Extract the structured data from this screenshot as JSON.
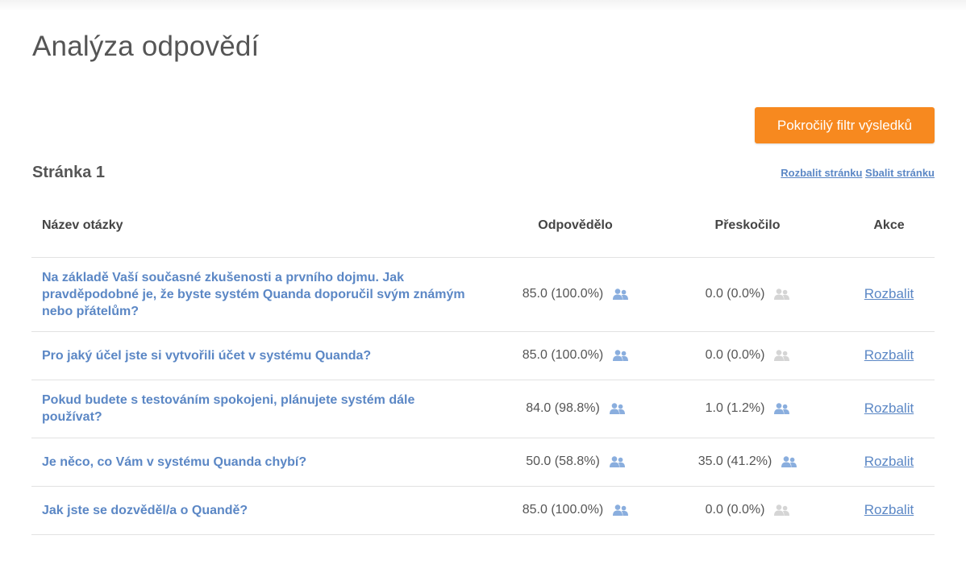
{
  "header": {
    "title": "Analýza odpovědí",
    "filter_button_label": "Pokročilý filtr výsledků"
  },
  "page_section": {
    "heading": "Stránka 1",
    "expand_page_label": "Rozbalit stránku",
    "collapse_page_label": "Sbalit stránku"
  },
  "table": {
    "columns": {
      "question": "Název otázky",
      "answered": "Odpovědělo",
      "skipped": "Přeskočilo",
      "action": "Akce"
    },
    "rows": [
      {
        "question": "Na základě Vaší současné zkušenosti a prvního dojmu. Jak pravděpodobné je, že byste systém Quanda doporučil svým známým nebo přátelům?",
        "answered": "85.0 (100.0%)",
        "skipped": "0.0 (0.0%)",
        "action": "Rozbalit",
        "answered_icon_color": "#8aaede",
        "skipped_icon_color": "#d5d5d5"
      },
      {
        "question": "Pro jaký účel jste si vytvořili účet v systému Quanda?",
        "answered": "85.0 (100.0%)",
        "skipped": "0.0 (0.0%)",
        "action": "Rozbalit",
        "answered_icon_color": "#8aaede",
        "skipped_icon_color": "#d5d5d5"
      },
      {
        "question": "Pokud budete s testováním spokojeni, plánujete systém dále používat?",
        "answered": "84.0 (98.8%)",
        "skipped": "1.0 (1.2%)",
        "action": "Rozbalit",
        "answered_icon_color": "#8aaede",
        "skipped_icon_color": "#8aaede"
      },
      {
        "question": "Je něco, co Vám v systému Quanda chybí?",
        "answered": "50.0 (58.8%)",
        "skipped": "35.0 (41.2%)",
        "action": "Rozbalit",
        "answered_icon_color": "#8aaede",
        "skipped_icon_color": "#8aaede"
      },
      {
        "question": "Jak jste se dozvěděl/a o Quandě?",
        "answered": "85.0 (100.0%)",
        "skipped": "0.0 (0.0%)",
        "action": "Rozbalit",
        "answered_icon_color": "#8aaede",
        "skipped_icon_color": "#d5d5d5"
      }
    ]
  },
  "colors": {
    "accent_orange": "#f7891f",
    "link_blue": "#5b87c5"
  },
  "icons": {
    "people": "people-icon"
  }
}
